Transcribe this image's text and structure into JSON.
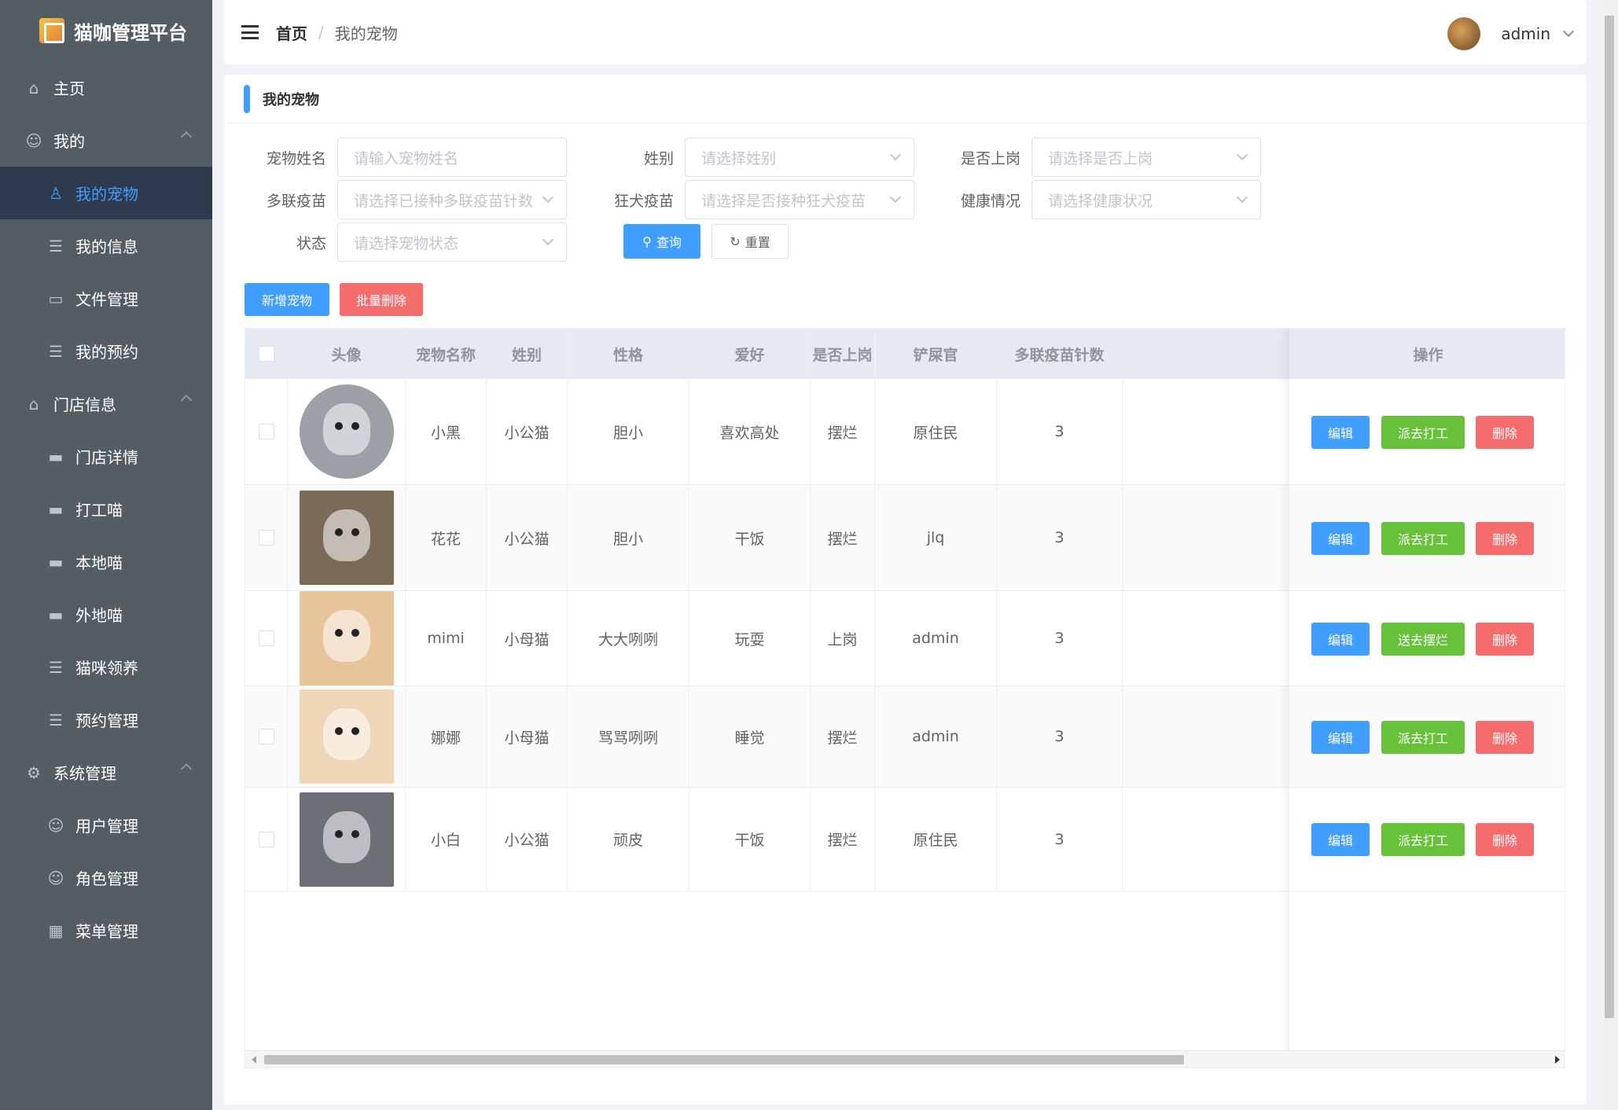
{
  "app": {
    "title": "猫咖管理平台"
  },
  "sidebar": {
    "items": [
      {
        "label": "主页",
        "icon": "home-icon",
        "type": "item"
      },
      {
        "label": "我的",
        "icon": "user-icon",
        "type": "group"
      },
      {
        "label": "我的宠物",
        "icon": "pet-icon",
        "type": "sub",
        "active": true
      },
      {
        "label": "我的信息",
        "icon": "document-icon",
        "type": "sub"
      },
      {
        "label": "文件管理",
        "icon": "folder-icon",
        "type": "sub"
      },
      {
        "label": "我的预约",
        "icon": "document-icon",
        "type": "sub"
      },
      {
        "label": "门店信息",
        "icon": "store-icon",
        "type": "group"
      },
      {
        "label": "门店详情",
        "icon": "monitor-icon",
        "type": "sub"
      },
      {
        "label": "打工喵",
        "icon": "monitor-icon",
        "type": "sub"
      },
      {
        "label": "本地喵",
        "icon": "monitor-icon",
        "type": "sub"
      },
      {
        "label": "外地喵",
        "icon": "monitor-icon",
        "type": "sub"
      },
      {
        "label": "猫咪领养",
        "icon": "document-icon",
        "type": "sub"
      },
      {
        "label": "预约管理",
        "icon": "document-icon",
        "type": "sub"
      },
      {
        "label": "系统管理",
        "icon": "gear-icon",
        "type": "group"
      },
      {
        "label": "用户管理",
        "icon": "user-icon",
        "type": "sub"
      },
      {
        "label": "角色管理",
        "icon": "user-icon",
        "type": "sub"
      },
      {
        "label": "菜单管理",
        "icon": "grid-icon",
        "type": "sub"
      }
    ]
  },
  "header": {
    "breadcrumb_home": "首页",
    "breadcrumb_sep": "/",
    "breadcrumb_current": "我的宠物",
    "username": "admin"
  },
  "card": {
    "title": "我的宠物"
  },
  "filters": {
    "pet_name": {
      "label": "宠物姓名",
      "placeholder": "请输入宠物姓名"
    },
    "gender": {
      "label": "姓别",
      "placeholder": "请选择姓别"
    },
    "on_duty": {
      "label": "是否上岗",
      "placeholder": "请选择是否上岗"
    },
    "vaccine": {
      "label": "多联疫苗",
      "placeholder": "请选择已接种多联疫苗针数"
    },
    "rabies": {
      "label": "狂犬疫苗",
      "placeholder": "请选择是否接种狂犬疫苗"
    },
    "health": {
      "label": "健康情况",
      "placeholder": "请选择健康状况"
    },
    "status": {
      "label": "状态",
      "placeholder": "请选择宠物状态"
    }
  },
  "buttons": {
    "query": "查询",
    "reset": "重置",
    "add": "新增宠物",
    "batch_delete": "批量删除"
  },
  "table": {
    "headers": [
      "头像",
      "宠物名称",
      "姓别",
      "性格",
      "爱好",
      "是否上岗",
      "铲屎官",
      "多联疫苗针数",
      "操作"
    ],
    "rows": [
      {
        "name": "小黑",
        "gender": "小公猫",
        "personality": "胆小",
        "hobby": "喜欢高处",
        "duty": "摆烂",
        "owner": "原住民",
        "vaccine": "3",
        "action": "派去打工",
        "img": "#9aa0a6"
      },
      {
        "name": "花花",
        "gender": "小公猫",
        "personality": "胆小",
        "hobby": "干饭",
        "duty": "摆烂",
        "owner": "jlq",
        "vaccine": "3",
        "action": "派去打工",
        "img": "#7b6a55"
      },
      {
        "name": "mimi",
        "gender": "小母猫",
        "personality": "大大咧咧",
        "hobby": "玩耍",
        "duty": "上岗",
        "owner": "admin",
        "vaccine": "3",
        "action": "送去摆烂",
        "img": "#e8c49a"
      },
      {
        "name": "娜娜",
        "gender": "小母猫",
        "personality": "骂骂咧咧",
        "hobby": "睡觉",
        "duty": "摆烂",
        "owner": "admin",
        "vaccine": "3",
        "action": "派去打工",
        "img": "#f0d6b8"
      },
      {
        "name": "小白",
        "gender": "小公猫",
        "personality": "顽皮",
        "hobby": "干饭",
        "duty": "摆烂",
        "owner": "原住民",
        "vaccine": "3",
        "action": "派去打工",
        "img": "#6c6f75"
      }
    ],
    "edit_label": "编辑",
    "delete_label": "删除"
  }
}
